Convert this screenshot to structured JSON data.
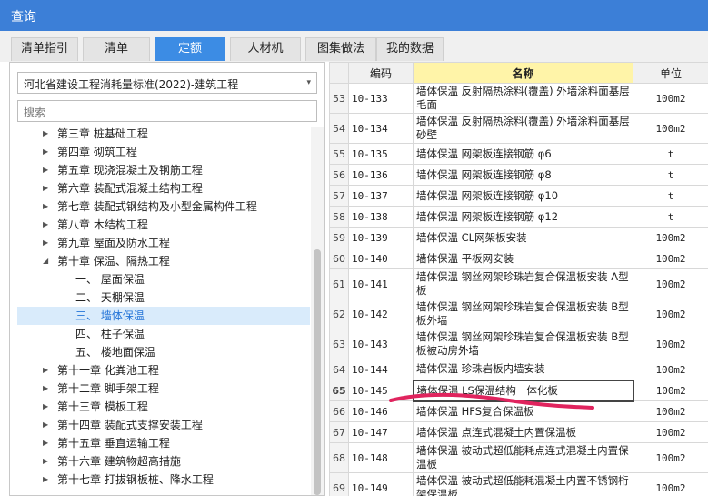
{
  "window": {
    "title": "查询"
  },
  "tabs": [
    {
      "label": "清单指引",
      "active": false
    },
    {
      "label": "清单",
      "active": false
    },
    {
      "label": "定额",
      "active": true
    },
    {
      "label": "人材机",
      "active": false
    },
    {
      "label": "图集做法",
      "active": false
    },
    {
      "label": "我的数据",
      "active": false
    }
  ],
  "left": {
    "standard_select": "河北省建设工程消耗量标准(2022)-建筑工程",
    "search_placeholder": "搜索",
    "tree": [
      {
        "label": "第三章 桩基础工程",
        "level": 0,
        "expanded": false,
        "selected": false
      },
      {
        "label": "第四章 砌筑工程",
        "level": 0,
        "expanded": false,
        "selected": false
      },
      {
        "label": "第五章 现浇混凝土及钢筋工程",
        "level": 0,
        "expanded": false,
        "selected": false
      },
      {
        "label": "第六章 装配式混凝土结构工程",
        "level": 0,
        "expanded": false,
        "selected": false
      },
      {
        "label": "第七章 装配式钢结构及小型金属构件工程",
        "level": 0,
        "expanded": false,
        "selected": false
      },
      {
        "label": "第八章 木结构工程",
        "level": 0,
        "expanded": false,
        "selected": false
      },
      {
        "label": "第九章 屋面及防水工程",
        "level": 0,
        "expanded": false,
        "selected": false
      },
      {
        "label": "第十章 保温、隔热工程",
        "level": 0,
        "expanded": true,
        "selected": false
      },
      {
        "label": "一、 屋面保温",
        "level": 1,
        "expanded": false,
        "selected": false
      },
      {
        "label": "二、 天棚保温",
        "level": 1,
        "expanded": false,
        "selected": false
      },
      {
        "label": "三、 墙体保温",
        "level": 1,
        "expanded": false,
        "selected": true
      },
      {
        "label": "四、 柱子保温",
        "level": 1,
        "expanded": false,
        "selected": false
      },
      {
        "label": "五、 楼地面保温",
        "level": 1,
        "expanded": false,
        "selected": false
      },
      {
        "label": "第十一章 化粪池工程",
        "level": 0,
        "expanded": false,
        "selected": false
      },
      {
        "label": "第十二章 脚手架工程",
        "level": 0,
        "expanded": false,
        "selected": false
      },
      {
        "label": "第十三章 模板工程",
        "level": 0,
        "expanded": false,
        "selected": false
      },
      {
        "label": "第十四章 装配式支撑安装工程",
        "level": 0,
        "expanded": false,
        "selected": false
      },
      {
        "label": "第十五章 垂直运输工程",
        "level": 0,
        "expanded": false,
        "selected": false
      },
      {
        "label": "第十六章 建筑物超高措施",
        "level": 0,
        "expanded": false,
        "selected": false
      },
      {
        "label": "第十七章 打拔钢板桩、降水工程",
        "level": 0,
        "expanded": false,
        "selected": false
      }
    ]
  },
  "grid": {
    "headers": {
      "code": "编码",
      "name": "名称",
      "unit": "单位"
    },
    "rows": [
      {
        "num": "53",
        "code": "10-133",
        "name": "墙体保温 反射隔热涂料(覆盖) 外墙涂料面基层 毛面",
        "unit": "100m2",
        "tall": true
      },
      {
        "num": "54",
        "code": "10-134",
        "name": "墙体保温 反射隔热涂料(覆盖) 外墙涂料面基层 砂壁",
        "unit": "100m2",
        "tall": true
      },
      {
        "num": "55",
        "code": "10-135",
        "name": "墙体保温 网架板连接钢筋 φ6",
        "unit": "t",
        "tall": false
      },
      {
        "num": "56",
        "code": "10-136",
        "name": "墙体保温 网架板连接钢筋 φ8",
        "unit": "t",
        "tall": false
      },
      {
        "num": "57",
        "code": "10-137",
        "name": "墙体保温 网架板连接钢筋 φ10",
        "unit": "t",
        "tall": false
      },
      {
        "num": "58",
        "code": "10-138",
        "name": "墙体保温 网架板连接钢筋 φ12",
        "unit": "t",
        "tall": false
      },
      {
        "num": "59",
        "code": "10-139",
        "name": "墙体保温 CL网架板安装",
        "unit": "100m2",
        "tall": false
      },
      {
        "num": "60",
        "code": "10-140",
        "name": "墙体保温 平板网安装",
        "unit": "100m2",
        "tall": false
      },
      {
        "num": "61",
        "code": "10-141",
        "name": "墙体保温 钢丝网架珍珠岩复合保温板安装 A型板",
        "unit": "100m2",
        "tall": true
      },
      {
        "num": "62",
        "code": "10-142",
        "name": "墙体保温 钢丝网架珍珠岩复合保温板安装 B型板外墙",
        "unit": "100m2",
        "tall": true
      },
      {
        "num": "63",
        "code": "10-143",
        "name": "墙体保温 钢丝网架珍珠岩复合保温板安装 B型板被动房外墙",
        "unit": "100m2",
        "tall": true
      },
      {
        "num": "64",
        "code": "10-144",
        "name": "墙体保温 珍珠岩板内墙安装",
        "unit": "100m2",
        "tall": false
      },
      {
        "num": "65",
        "code": "10-145",
        "name": "墙体保温 LS保温结构一体化板",
        "unit": "100m2",
        "tall": false,
        "current": true
      },
      {
        "num": "66",
        "code": "10-146",
        "name": "墙体保温 HFS复合保温板",
        "unit": "100m2",
        "tall": false
      },
      {
        "num": "67",
        "code": "10-147",
        "name": "墙体保温 点连式混凝土内置保温板",
        "unit": "100m2",
        "tall": false
      },
      {
        "num": "68",
        "code": "10-148",
        "name": "墙体保温 被动式超低能耗点连式混凝土内置保温板",
        "unit": "100m2",
        "tall": true
      },
      {
        "num": "69",
        "code": "10-149",
        "name": "墙体保温 被动式超低能耗混凝土内置不锈钢桁架保温板",
        "unit": "100m2",
        "tall": true
      }
    ]
  },
  "colors": {
    "title_bar": "#3c7fd7",
    "active_tab": "#3c8ce4",
    "header_highlight": "#fff4a8",
    "annotation": "#e0245e"
  }
}
